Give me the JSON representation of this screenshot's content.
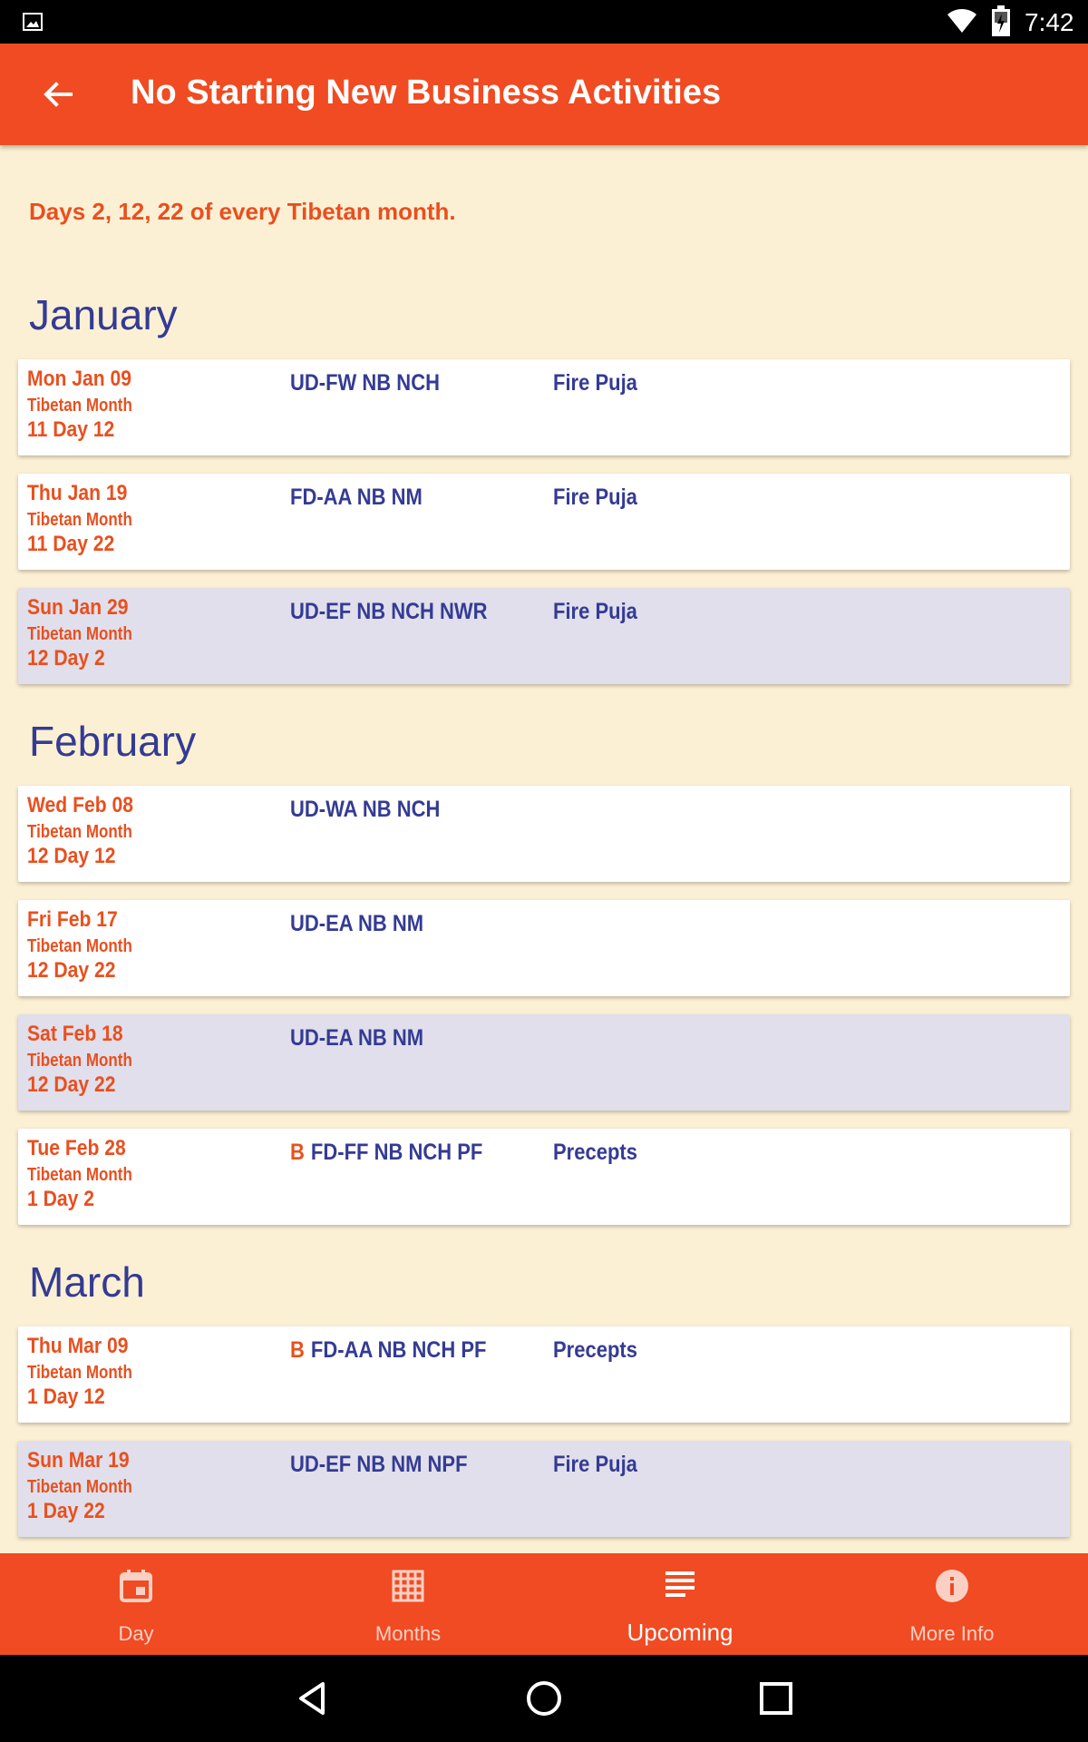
{
  "status_bar": {
    "time": "7:42"
  },
  "app_bar": {
    "title": "No Starting New Business Activities"
  },
  "subtitle": "Days 2, 12, 22 of every Tibetan month.",
  "months": [
    {
      "name": "January"
    },
    {
      "name": "February"
    },
    {
      "name": "March"
    }
  ],
  "entries": [
    {
      "date": "Mon Jan 09",
      "tib_month": "Tibetan Month",
      "tib_day": "11 Day 12",
      "prefix": "",
      "codes": "UD-FW NB NCH",
      "event": "Fire Puja",
      "alt": false
    },
    {
      "date": "Thu Jan 19",
      "tib_month": "Tibetan Month",
      "tib_day": "11 Day 22",
      "prefix": "",
      "codes": "FD-AA NB NM",
      "event": "Fire Puja",
      "alt": false
    },
    {
      "date": "Sun Jan 29",
      "tib_month": "Tibetan Month",
      "tib_day": "12 Day 2",
      "prefix": "",
      "codes": "UD-EF NB NCH NWR",
      "event": "Fire Puja",
      "alt": true
    },
    {
      "date": "Wed Feb 08",
      "tib_month": "Tibetan Month",
      "tib_day": "12 Day 12",
      "prefix": "",
      "codes": "UD-WA NB NCH",
      "event": "",
      "alt": false
    },
    {
      "date": "Fri Feb 17",
      "tib_month": "Tibetan Month",
      "tib_day": "12 Day 22",
      "prefix": "",
      "codes": "UD-EA NB NM",
      "event": "",
      "alt": false
    },
    {
      "date": "Sat Feb 18",
      "tib_month": "Tibetan Month",
      "tib_day": "12 Day 22",
      "prefix": "",
      "codes": "UD-EA NB NM",
      "event": "",
      "alt": true
    },
    {
      "date": "Tue Feb 28",
      "tib_month": "Tibetan Month",
      "tib_day": "1 Day 2",
      "prefix": "B",
      "codes": "FD-FF NB NCH PF",
      "event": "Precepts",
      "alt": false
    },
    {
      "date": "Thu Mar 09",
      "tib_month": "Tibetan Month",
      "tib_day": "1 Day 12",
      "prefix": "B",
      "codes": "FD-AA NB NCH PF",
      "event": "Precepts",
      "alt": false
    },
    {
      "date": "Sun Mar 19",
      "tib_month": "Tibetan Month",
      "tib_day": "1 Day 22",
      "prefix": "",
      "codes": "UD-EF NB NM NPF",
      "event": "Fire Puja",
      "alt": true
    }
  ],
  "bottom_nav": [
    {
      "label": "Day",
      "icon": "calendar-day-icon",
      "active": false
    },
    {
      "label": "Months",
      "icon": "grid-icon",
      "active": false
    },
    {
      "label": "Upcoming",
      "icon": "list-icon",
      "active": true
    },
    {
      "label": "More Info",
      "icon": "info-icon",
      "active": false
    }
  ],
  "colors": {
    "primary": "#f04b22",
    "background": "#fcf0d4",
    "accent_text": "#e8501f",
    "indigo_text": "#343b93",
    "alt_card": "#e0dfeb"
  }
}
